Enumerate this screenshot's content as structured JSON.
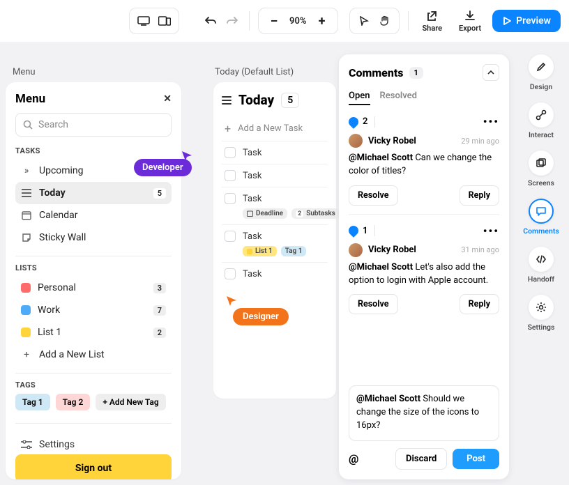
{
  "topbar": {
    "zoom": "90%",
    "share": "Share",
    "export": "Export",
    "preview": "Preview"
  },
  "crumbs": {
    "menu": "Menu",
    "today": "Today (Default List)"
  },
  "cursors": {
    "developer": "Developer",
    "designer": "Designer"
  },
  "menu": {
    "title": "Menu",
    "search_placeholder": "Search",
    "tasks_label": "TASKS",
    "tasks": [
      {
        "label": "Upcoming",
        "count": null
      },
      {
        "label": "Today",
        "count": "5",
        "active": true
      },
      {
        "label": "Calendar",
        "count": null
      },
      {
        "label": "Sticky Wall",
        "count": null
      }
    ],
    "lists_label": "LISTS",
    "lists": [
      {
        "label": "Personal",
        "color": "#ff6b6b",
        "count": "3"
      },
      {
        "label": "Work",
        "color": "#4dabf7",
        "count": "7"
      },
      {
        "label": "List 1",
        "color": "#ffd43b",
        "count": "2"
      }
    ],
    "add_list": "Add a New List",
    "tags_label": "TAGS",
    "tags": [
      {
        "label": "Tag 1",
        "bg": "#cfe8f5"
      },
      {
        "label": "Tag 2",
        "bg": "#ffd6d6"
      }
    ],
    "add_tag": "+ Add New Tag",
    "settings": "Settings",
    "sign_out": "Sign out"
  },
  "today": {
    "title": "Today",
    "count": "5",
    "add_task": "Add a New Task",
    "tasks": [
      {
        "label": "Task",
        "meta": []
      },
      {
        "label": "Task",
        "meta": []
      },
      {
        "label": "Task",
        "meta": [
          {
            "t": "deadline",
            "label": "Deadline"
          },
          {
            "t": "subtasks",
            "n": "2",
            "label": "Subtasks"
          }
        ]
      },
      {
        "label": "Task",
        "meta": [
          {
            "t": "list",
            "color": "#ffd43b",
            "label": "List 1"
          },
          {
            "t": "tag",
            "label": "Tag 1"
          }
        ]
      },
      {
        "label": "Task",
        "meta": []
      }
    ]
  },
  "comments": {
    "title": "Comments",
    "count": "1",
    "tabs": {
      "open": "Open",
      "resolved": "Resolved"
    },
    "threads": [
      {
        "num": "2",
        "author": "Vicky Robel",
        "time": "29 min ago",
        "mention": "@Michael Scott",
        "text": " Can we change the color of titles?",
        "resolve": "Resolve",
        "reply": "Reply"
      },
      {
        "num": "1",
        "author": "Vicky Robel",
        "time": "31 min ago",
        "mention": "@Michael Scott",
        "text": " Let's also add the option to login with Apple account.",
        "resolve": "Resolve",
        "reply": "Reply"
      }
    ],
    "compose_mention": "@Michael Scott",
    "compose_text": " Should we change the size of the icons to 16px?",
    "discard": "Discard",
    "post": "Post"
  },
  "rail": [
    {
      "label": "Design"
    },
    {
      "label": "Interact"
    },
    {
      "label": "Screens"
    },
    {
      "label": "Comments",
      "active": true
    },
    {
      "label": "Handoff"
    },
    {
      "label": "Settings"
    }
  ]
}
